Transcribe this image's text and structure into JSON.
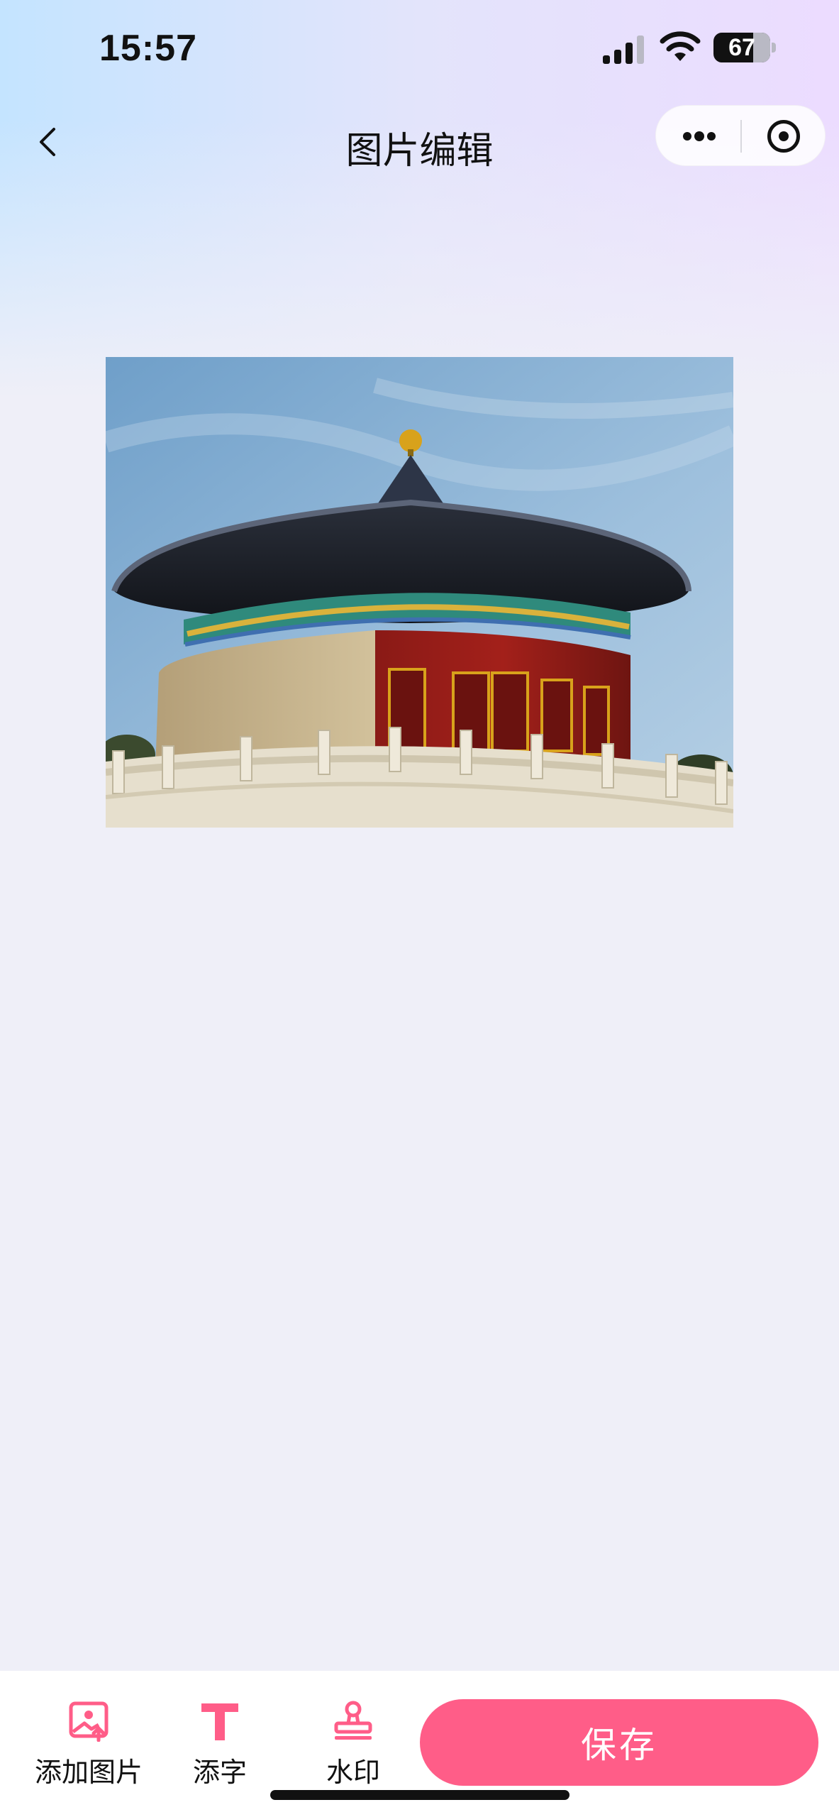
{
  "status_bar": {
    "time": "15:57",
    "battery": "67"
  },
  "nav": {
    "title": "图片编辑"
  },
  "photo": {
    "subject": "Imperial Vault of Heaven, Temple of Heaven"
  },
  "toolbar": {
    "add_image_label": "添加图片",
    "add_text_label": "添字",
    "watermark_label": "水印",
    "save_label": "保存"
  },
  "colors": {
    "accent": "#ff5d88",
    "background": "#efeff8"
  },
  "icons": {
    "back": "chevron-left-icon",
    "more": "more-dots-icon",
    "record": "target-circle-icon",
    "add_image": "image-add-icon",
    "add_text": "text-t-icon",
    "watermark": "stamp-icon"
  }
}
